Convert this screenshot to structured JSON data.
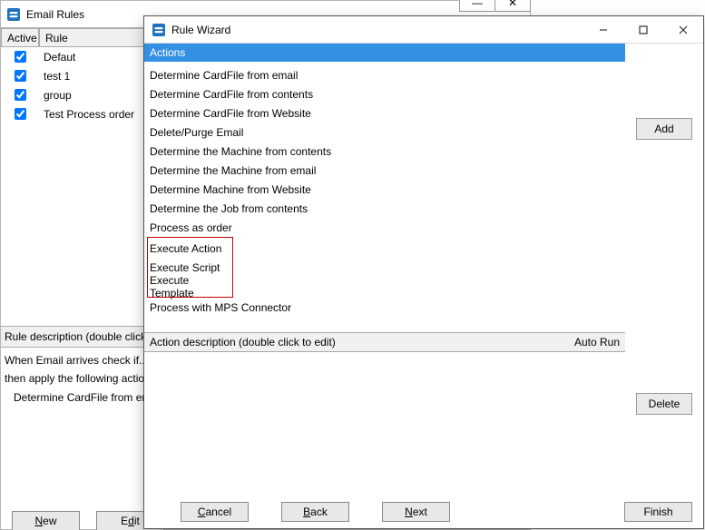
{
  "emailRules": {
    "title": "Email Rules",
    "columns": {
      "active": "Active",
      "rule": "Rule"
    },
    "rows": [
      {
        "active": true,
        "name": "Defaut"
      },
      {
        "active": true,
        "name": "test 1"
      },
      {
        "active": true,
        "name": "group"
      },
      {
        "active": true,
        "name": "Test Process order"
      }
    ],
    "descHeader": "Rule description (double click to e",
    "descLine1": "When Email arrives check if..",
    "descLine2": "then apply the following actions.",
    "descLine3": "Determine CardFile from email",
    "buttons": {
      "new_pre": "",
      "new_key": "N",
      "new_post": "ew",
      "edit_pre": "E",
      "edit_key": "d",
      "edit_post": "it"
    },
    "windowControls": {
      "min": "—",
      "close": "✕"
    }
  },
  "wizard": {
    "title": "Rule Wizard",
    "actionsHeader": "Actions",
    "actions": [
      "Determine CardFile from email",
      "Determine CardFile from contents",
      "Determine CardFile from Website",
      "Delete/Purge Email",
      "Determine the Machine from contents",
      "Determine the Machine from email",
      "Determine Machine from Website",
      "Determine the Job from contents",
      "Process as order"
    ],
    "highlightActions": [
      "Execute Action",
      "Execute Script",
      "Execute Template"
    ],
    "actionsAfter": [
      "Process with MPS Connector"
    ],
    "actionDescLabel": "Action description (double click to edit)",
    "autoRun": "Auto Run",
    "buttons": {
      "add": "Add",
      "delete": "Delete",
      "finish": "Finish",
      "cancel_pre": "",
      "cancel_key": "C",
      "cancel_post": "ancel",
      "back_pre": "",
      "back_key": "B",
      "back_post": "ack",
      "next_pre": "",
      "next_key": "N",
      "next_post": "ext"
    }
  }
}
